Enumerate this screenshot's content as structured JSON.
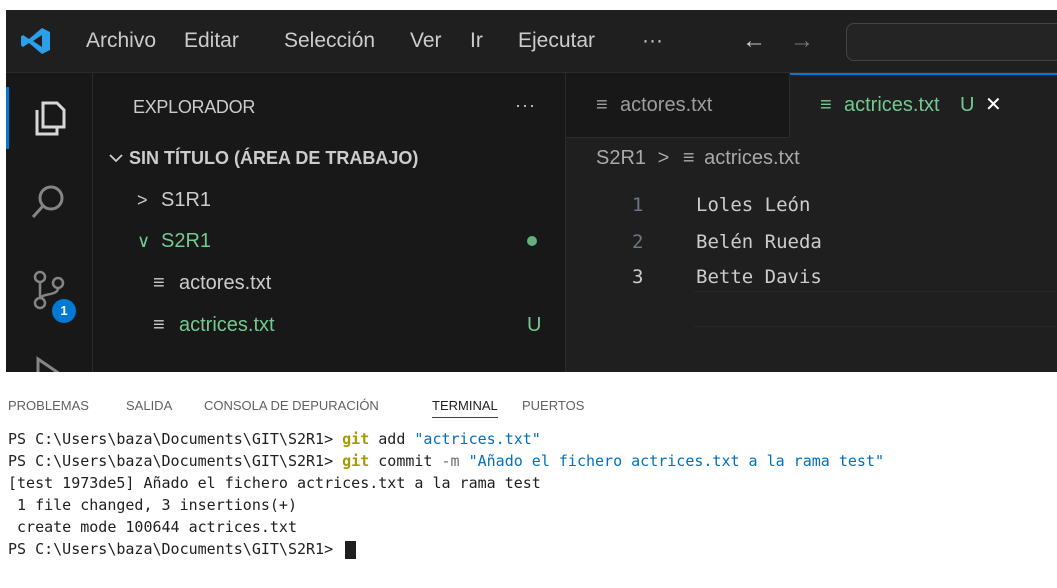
{
  "menu": [
    "Archivo",
    "Editar",
    "Selección",
    "Ver",
    "Ir",
    "Ejecutar",
    "···"
  ],
  "nav": {
    "back": "←",
    "forward": "→"
  },
  "activity": {
    "scm_badge": "1"
  },
  "explorer": {
    "title": "EXPLORADOR",
    "more": "···",
    "workspace": "SIN TÍTULO (ÁREA DE TRABAJO)",
    "items": [
      {
        "label": "S1R1",
        "chevron": ">"
      },
      {
        "label": "S2R1",
        "chevron": "∨"
      },
      {
        "label": "actores.txt",
        "status": ""
      },
      {
        "label": "actrices.txt",
        "status": "U"
      }
    ]
  },
  "tabs": [
    {
      "label": "actores.txt"
    },
    {
      "label": "actrices.txt",
      "status": "U",
      "close": "✕"
    }
  ],
  "breadcrumb": {
    "folder": "S2R1",
    "sep": ">",
    "file": "actrices.txt"
  },
  "editor": {
    "lines": [
      {
        "num": "1",
        "text": "Loles León"
      },
      {
        "num": "2",
        "text": "Belén Rueda"
      },
      {
        "num": "3",
        "text": "Bette Davis"
      }
    ]
  },
  "panel": {
    "tabs": [
      "PROBLEMAS",
      "SALIDA",
      "CONSOLA DE DEPURACIÓN",
      "TERMINAL",
      "PUERTOS"
    ],
    "active_tab": "TERMINAL"
  },
  "terminal": {
    "prompt": "PS C:\\Users\\baza\\Documents\\GIT\\S2R1> ",
    "cmd1": {
      "git": "git",
      "rest": " add ",
      "str": "\"actrices.txt\""
    },
    "cmd2": {
      "git": "git",
      "rest": " commit ",
      "flag": "-m",
      "str": " \"Añado el fichero actrices.txt a la rama test\""
    },
    "out1": "[test 1973de5] Añado el fichero actrices.txt a la rama test",
    "out2": " 1 file changed, 3 insertions(+)",
    "out3": " create mode 100644 actrices.txt"
  },
  "colors": {
    "accent": "#0078d4",
    "untracked": "#73c991",
    "background": "#181818"
  }
}
